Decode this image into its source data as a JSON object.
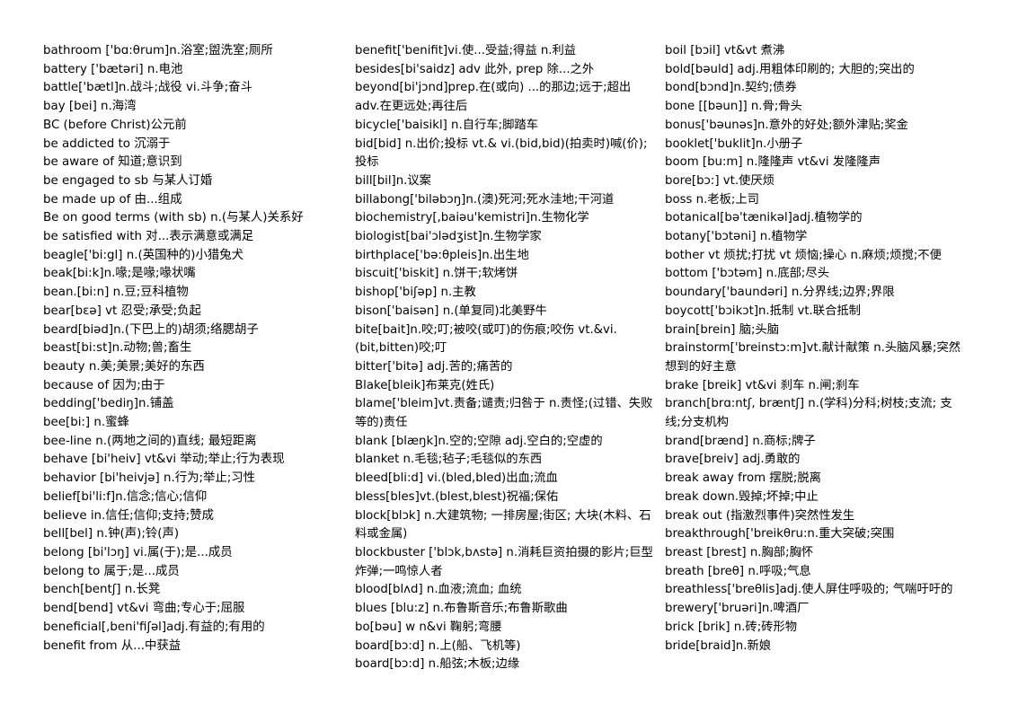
{
  "document": {
    "type": "vocabulary-word-list",
    "layout": "three-column",
    "columns": [
      {
        "id": "column-1",
        "entries": [
          "bathroom ['bɑ:θrum]n.浴室;盥洗室;厕所",
          "battery ['bætəri] n.电池",
          "battle['bætl]n.战斗;战役 vi.斗争;奋斗",
          "bay [bei] n.海湾",
          "BC (before Christ)公元前",
          "be addicted to 沉溺于",
          "be aware of 知道;意识到",
          "be engaged to sb 与某人订婚",
          "be made up of 由...组成",
          "Be on good terms (with sb) n.(与某人)关系好",
          "be satisfied with 对...表示满意或满足",
          "beagle['bi:gl] n.(英国种的)小猎兔犬",
          "beak[bi:k]n.喙;是喙;喙状嘴",
          "bean.[bi:n] n.豆;豆科植物",
          "bear[bɛə] vt 忍受;承受;负起",
          "beard[biəd]n.(下巴上的)胡须;络腮胡子",
          "beast[bi:st]n.动物;兽;畜生",
          "beauty n.美;美景;美好的东西",
          "because of 因为;由于",
          "bedding['bediŋ]n.铺盖",
          "bee[bi:] n.蜜蜂",
          "bee-line n.(两地之间的)直线; 最短距离",
          "behave [bi'heiv] vt&vi 举动;举止;行为表现",
          "behavior [bi'heivjə] n.行为;举止;习性",
          "belief[bi'li:f]n.信念;信心;信仰",
          "believe in.信任;信仰;支持;赞成",
          "bell[bel] n.钟(声);铃(声)",
          "belong [bi'lɔŋ] vi.属(于);是...成员",
          "belong to 属于;是...成员",
          "bench[bentʃ] n.长凳",
          "bend[bend] vt&vi 弯曲;专心于;屈服",
          "beneficial[,beni'fiʃəl]adj.有益的;有用的",
          "benefit from 从...中获益"
        ]
      },
      {
        "id": "column-2",
        "entries": [
          "benefit['benifit]vi.使...受益;得益 n.利益",
          "besides[bi'saidz] adv 此外, prep 除...之外",
          "beyond[bi'jɔnd]prep.在(或向) ...的那边;远于;超出 adv.在更远处;再往后",
          "bicycle['baisikl] n.自行车;脚踏车",
          "bid[bid] n.出价;投标 vt.& vi.(bid,bid)(拍卖时)喊(价);投标",
          "bill[bil]n.议案",
          "billabong['biləbɔŋ]n.(澳)死河;死水洼地;干河道",
          "biochemistry[,baiəu'kemistri]n.生物化学",
          "biologist[bai'ɔlədʒist]n.生物学家",
          "birthplace['bə:θpleis]n.出生地",
          "biscuit['biskit] n.饼干;软烤饼",
          "bishop['biʃəp] n.主教",
          "bison['baisən] n.(单复同)北美野牛",
          "bite[bait]n.咬;叮;被咬(或叮)的伤痕;咬伤 vt.&vi.(bit,bitten)咬;叮",
          "bitter['bitə] adj.苦的;痛苦的",
          "Blake[bleik]布莱克(姓氏)",
          "blame['bleim]vt.责备;谴责;归咎于 n.责怪;(过错、失败等的)责任",
          "blank [blæŋk]n.空的;空隙 adj.空白的;空虚的",
          "blanket n.毛毯;毡子;毛毯似的东西",
          "bleed[bli:d] vi.(bled,bled)出血;流血",
          "bless[bles]vt.(blest,blest)祝福;保佑",
          "block[blɔk] n.大建筑物; 一排房屋;街区; 大块(木料、石料或金属)",
          "blockbuster ['blɔk,bʌstə] n.消耗巨资拍摄的影片;巨型炸弹;一鸣惊人者",
          "blood[blʌd] n.血液;流血; 血统",
          "blues [blu:z] n.布鲁斯音乐;布鲁斯歌曲",
          "bo[bəu] w n&vi 鞠躬;弯腰",
          "board[bɔ:d] n.上(船、飞机等)",
          "board[bɔ:d] n.船弦;木板;边缘"
        ]
      },
      {
        "id": "column-3",
        "entries": [
          "boil [bɔil] vt&vt 煮沸",
          "bold[bəuld] adj.用粗体印刷的; 大胆的;突出的",
          "bond[bɔnd]n.契约;债券",
          "bone [[bəun]] n.骨;骨头",
          "bonus['bəunəs]n.意外的好处;额外津贴;奖金",
          "booklet['buklit]n.小册子",
          "boom [bu:m] n.隆隆声 vt&vi 发隆隆声",
          "bore[bɔ:] vt.使厌烦",
          "boss n.老板;上司",
          "botanical[bə'tænikəl]adj.植物学的",
          "botany['bɔtəni] n.植物学",
          "bother vt 烦扰;打扰 vt 烦恼;操心 n.麻烦;烦搅;不便",
          "bottom ['bɔtəm] n.底部;尽头",
          "boundary['baundəri] n.分界线;边界;界限",
          "boycott['bɔikɔt]n.抵制 vt.联合抵制",
          "brain[brein] 脑;头脑",
          "brainstorm['breinstɔ:m]vt.献计献策 n.头脑风暴;突然想到的好主意",
          "brake [breik] vt&vi 刹车 n.闸;刹车",
          "branch[brɑ:ntʃ, bræntʃ] n.(学科)分科;树枝;支流; 支线;分支机构",
          "brand[brænd] n.商标;牌子",
          "brave[breiv] adj.勇敢的",
          "break away from 摆脱;脱离",
          "break down.毁掉;坏掉;中止",
          "break out (指激烈事件)突然性发生",
          "breakthrough['breikθru:n.重大突破;突围",
          "breast [brest] n.胸部;胸怀",
          "breath [breθ] n.呼吸;气息",
          "breathless['breθlis]adj.使人屏住呼吸的; 气喘吁吁的",
          "brewery['bruəri]n.啤酒厂",
          "brick [brik] n.砖;砖形物",
          "bride[braid]n.新娘"
        ]
      }
    ]
  }
}
